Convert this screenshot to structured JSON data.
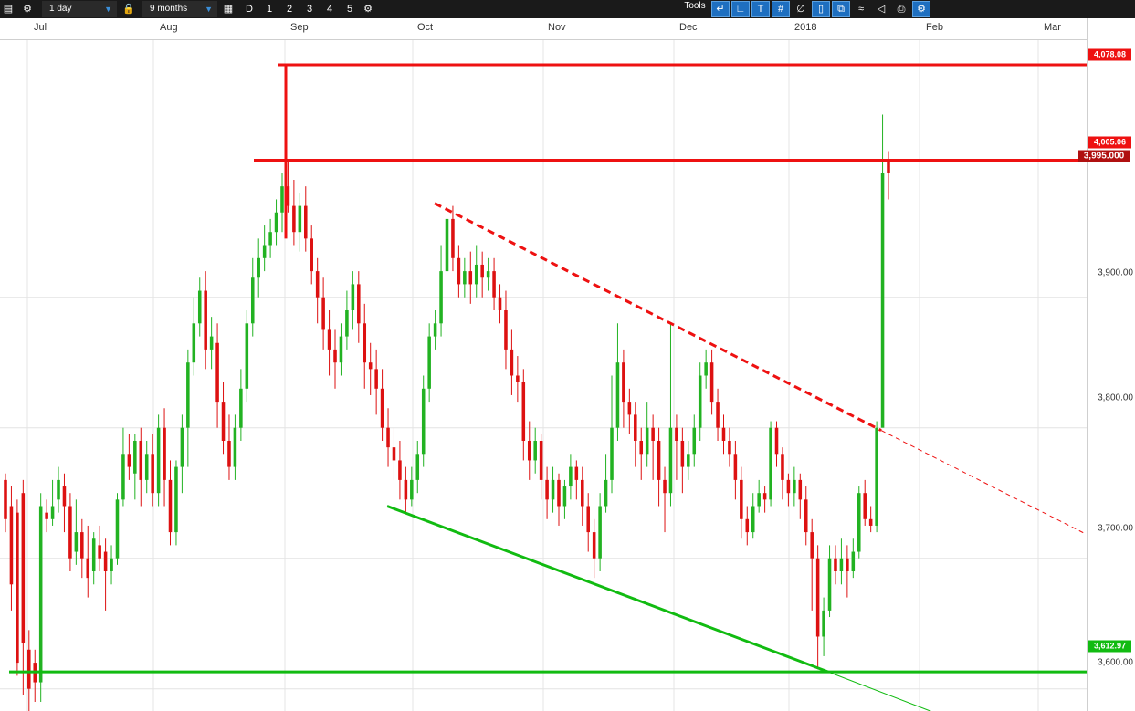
{
  "toolbar": {
    "interval": "1 day",
    "range": "9 months",
    "period_buttons": [
      "D",
      "1",
      "2",
      "3",
      "4",
      "5"
    ],
    "tools_label": "Tools"
  },
  "colors": {
    "up": "#22b222",
    "down": "#dd1111",
    "resistance": "#ee1111",
    "support": "#11bb11",
    "price_badge": "#b01010"
  },
  "badges": {
    "resistance_high": "4,078.08",
    "resistance_mid": "4,005.06",
    "last_price": "3,995.000",
    "support": "3,612.97"
  },
  "chart_data": {
    "type": "candlestick",
    "x_labels": [
      "Jul",
      "Aug",
      "Sep",
      "Oct",
      "Nov",
      "Dec",
      "2018",
      "Feb",
      "Mar"
    ],
    "y_ticks": [
      "3,600.00",
      "3,700.00",
      "3,800.00",
      "3,900.00"
    ],
    "y_tick_values": [
      3600,
      3700,
      3800,
      3900
    ],
    "ylim": [
      3583,
      4097
    ],
    "levels": [
      {
        "name": "resistance-high",
        "value": 4078.08
      },
      {
        "name": "resistance-mid",
        "value": 4005.06
      },
      {
        "name": "support",
        "value": 3612.97
      }
    ],
    "last_price": 3995.0,
    "candles": [
      [
        3760,
        3730,
        3765,
        3720
      ],
      [
        3740,
        3680,
        3755,
        3660
      ],
      [
        3735,
        3620,
        3745,
        3610
      ],
      [
        3750,
        3635,
        3760,
        3595
      ],
      [
        3630,
        3600,
        3645,
        3575
      ],
      [
        3620,
        3605,
        3630,
        3590
      ],
      [
        3605,
        3740,
        3750,
        3590
      ],
      [
        3735,
        3730,
        3745,
        3720
      ],
      [
        3730,
        3740,
        3760,
        3725
      ],
      [
        3745,
        3760,
        3770,
        3735
      ],
      [
        3755,
        3740,
        3765,
        3720
      ],
      [
        3740,
        3700,
        3750,
        3690
      ],
      [
        3705,
        3720,
        3745,
        3695
      ],
      [
        3720,
        3700,
        3730,
        3685
      ],
      [
        3700,
        3685,
        3725,
        3670
      ],
      [
        3690,
        3715,
        3720,
        3680
      ],
      [
        3710,
        3700,
        3725,
        3690
      ],
      [
        3705,
        3690,
        3715,
        3660
      ],
      [
        3690,
        3700,
        3710,
        3680
      ],
      [
        3700,
        3745,
        3750,
        3695
      ],
      [
        3745,
        3780,
        3800,
        3740
      ],
      [
        3780,
        3770,
        3795,
        3760
      ],
      [
        3765,
        3790,
        3795,
        3745
      ],
      [
        3790,
        3760,
        3800,
        3740
      ],
      [
        3760,
        3780,
        3790,
        3750
      ],
      [
        3780,
        3750,
        3795,
        3740
      ],
      [
        3750,
        3800,
        3810,
        3740
      ],
      [
        3800,
        3760,
        3815,
        3740
      ],
      [
        3760,
        3720,
        3775,
        3710
      ],
      [
        3720,
        3770,
        3775,
        3710
      ],
      [
        3770,
        3800,
        3810,
        3750
      ],
      [
        3800,
        3850,
        3860,
        3770
      ],
      [
        3850,
        3880,
        3900,
        3840
      ],
      [
        3880,
        3905,
        3915,
        3870
      ],
      [
        3905,
        3860,
        3920,
        3845
      ],
      [
        3860,
        3870,
        3885,
        3845
      ],
      [
        3865,
        3820,
        3880,
        3800
      ],
      [
        3820,
        3790,
        3835,
        3780
      ],
      [
        3790,
        3770,
        3810,
        3760
      ],
      [
        3770,
        3800,
        3810,
        3760
      ],
      [
        3800,
        3830,
        3845,
        3790
      ],
      [
        3830,
        3880,
        3890,
        3820
      ],
      [
        3880,
        3915,
        3930,
        3870
      ],
      [
        3915,
        3930,
        3945,
        3900
      ],
      [
        3930,
        3940,
        3955,
        3920
      ],
      [
        3940,
        3950,
        3960,
        3930
      ],
      [
        3950,
        3965,
        3975,
        3940
      ],
      [
        3965,
        3985,
        3995,
        3950
      ],
      [
        3985,
        3970,
        4005,
        3965
      ],
      [
        3970,
        3950,
        3990,
        3940
      ],
      [
        3950,
        3970,
        3980,
        3935
      ],
      [
        3970,
        3945,
        3985,
        3935
      ],
      [
        3945,
        3920,
        3955,
        3910
      ],
      [
        3920,
        3900,
        3930,
        3880
      ],
      [
        3900,
        3875,
        3915,
        3860
      ],
      [
        3875,
        3860,
        3890,
        3840
      ],
      [
        3860,
        3850,
        3875,
        3830
      ],
      [
        3850,
        3870,
        3880,
        3840
      ],
      [
        3870,
        3890,
        3905,
        3860
      ],
      [
        3890,
        3910,
        3920,
        3875
      ],
      [
        3910,
        3880,
        3920,
        3865
      ],
      [
        3880,
        3850,
        3895,
        3830
      ],
      [
        3850,
        3845,
        3865,
        3825
      ],
      [
        3845,
        3830,
        3860,
        3810
      ],
      [
        3830,
        3800,
        3845,
        3790
      ],
      [
        3800,
        3785,
        3815,
        3770
      ],
      [
        3785,
        3775,
        3800,
        3760
      ],
      [
        3775,
        3760,
        3790,
        3745
      ],
      [
        3760,
        3745,
        3770,
        3735
      ],
      [
        3745,
        3760,
        3770,
        3740
      ],
      [
        3760,
        3780,
        3790,
        3750
      ],
      [
        3780,
        3830,
        3840,
        3770
      ],
      [
        3830,
        3870,
        3880,
        3820
      ],
      [
        3870,
        3880,
        3890,
        3860
      ],
      [
        3880,
        3920,
        3940,
        3870
      ],
      [
        3920,
        3960,
        3975,
        3910
      ],
      [
        3960,
        3930,
        3970,
        3920
      ],
      [
        3930,
        3910,
        3940,
        3900
      ],
      [
        3910,
        3920,
        3930,
        3900
      ],
      [
        3920,
        3910,
        3935,
        3895
      ],
      [
        3910,
        3925,
        3940,
        3900
      ],
      [
        3925,
        3915,
        3935,
        3900
      ],
      [
        3915,
        3920,
        3930,
        3905
      ],
      [
        3920,
        3900,
        3930,
        3890
      ],
      [
        3900,
        3890,
        3910,
        3880
      ],
      [
        3890,
        3860,
        3905,
        3845
      ],
      [
        3860,
        3840,
        3875,
        3825
      ],
      [
        3840,
        3835,
        3855,
        3820
      ],
      [
        3835,
        3790,
        3845,
        3775
      ],
      [
        3790,
        3775,
        3805,
        3760
      ],
      [
        3775,
        3790,
        3800,
        3765
      ],
      [
        3790,
        3760,
        3795,
        3745
      ],
      [
        3760,
        3745,
        3770,
        3730
      ],
      [
        3745,
        3760,
        3770,
        3735
      ],
      [
        3760,
        3740,
        3765,
        3725
      ],
      [
        3740,
        3755,
        3760,
        3730
      ],
      [
        3755,
        3770,
        3780,
        3745
      ],
      [
        3770,
        3760,
        3775,
        3745
      ],
      [
        3760,
        3740,
        3770,
        3725
      ],
      [
        3740,
        3720,
        3750,
        3705
      ],
      [
        3720,
        3700,
        3730,
        3685
      ],
      [
        3700,
        3740,
        3750,
        3690
      ],
      [
        3740,
        3760,
        3780,
        3735
      ],
      [
        3760,
        3800,
        3840,
        3750
      ],
      [
        3800,
        3850,
        3880,
        3790
      ],
      [
        3850,
        3820,
        3860,
        3800
      ],
      [
        3820,
        3810,
        3830,
        3795
      ],
      [
        3810,
        3790,
        3820,
        3770
      ],
      [
        3790,
        3780,
        3800,
        3760
      ],
      [
        3780,
        3800,
        3820,
        3770
      ],
      [
        3800,
        3790,
        3810,
        3760
      ],
      [
        3790,
        3760,
        3800,
        3740
      ],
      [
        3760,
        3750,
        3770,
        3720
      ],
      [
        3750,
        3800,
        3880,
        3740
      ],
      [
        3800,
        3790,
        3810,
        3760
      ],
      [
        3790,
        3770,
        3800,
        3750
      ],
      [
        3770,
        3780,
        3790,
        3760
      ],
      [
        3780,
        3800,
        3810,
        3770
      ],
      [
        3800,
        3840,
        3850,
        3790
      ],
      [
        3840,
        3850,
        3860,
        3830
      ],
      [
        3850,
        3820,
        3860,
        3810
      ],
      [
        3820,
        3800,
        3830,
        3790
      ],
      [
        3800,
        3790,
        3810,
        3780
      ],
      [
        3790,
        3780,
        3800,
        3770
      ],
      [
        3780,
        3760,
        3790,
        3745
      ],
      [
        3760,
        3730,
        3770,
        3715
      ],
      [
        3730,
        3720,
        3740,
        3710
      ],
      [
        3720,
        3740,
        3750,
        3715
      ],
      [
        3740,
        3750,
        3760,
        3735
      ],
      [
        3750,
        3745,
        3755,
        3735
      ],
      [
        3745,
        3800,
        3805,
        3740
      ],
      [
        3800,
        3780,
        3805,
        3770
      ],
      [
        3780,
        3760,
        3785,
        3745
      ],
      [
        3760,
        3750,
        3765,
        3740
      ],
      [
        3750,
        3760,
        3770,
        3740
      ],
      [
        3760,
        3745,
        3765,
        3730
      ],
      [
        3745,
        3720,
        3755,
        3710
      ],
      [
        3720,
        3700,
        3730,
        3660
      ],
      [
        3700,
        3640,
        3710,
        3615
      ],
      [
        3640,
        3660,
        3670,
        3625
      ],
      [
        3660,
        3700,
        3710,
        3655
      ],
      [
        3700,
        3690,
        3710,
        3680
      ],
      [
        3690,
        3700,
        3715,
        3680
      ],
      [
        3700,
        3690,
        3710,
        3670
      ],
      [
        3690,
        3705,
        3715,
        3685
      ],
      [
        3705,
        3750,
        3755,
        3700
      ],
      [
        3750,
        3730,
        3760,
        3725
      ],
      [
        3730,
        3725,
        3740,
        3720
      ],
      [
        3725,
        3800,
        3805,
        3720
      ],
      [
        3800,
        3995,
        4040,
        3990
      ],
      [
        4005,
        3995,
        4012,
        3975
      ]
    ]
  }
}
